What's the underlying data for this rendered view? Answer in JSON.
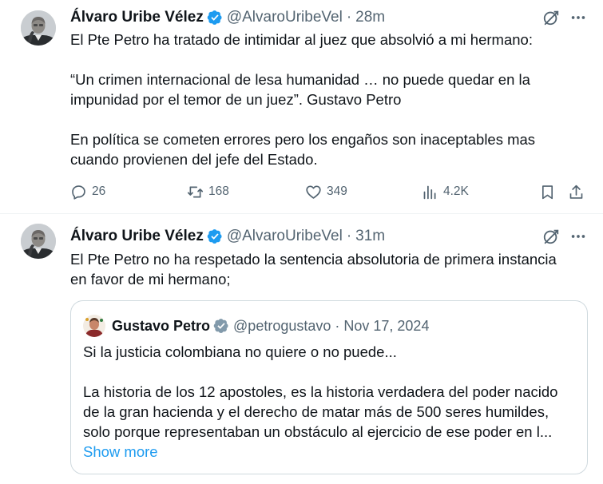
{
  "tweets": [
    {
      "author": {
        "name": "Álvaro Uribe Vélez",
        "handle": "@AlvaroUribeVel",
        "time": "28m",
        "avatar_icon": "person-portrait-icon"
      },
      "text_lines": [
        "El Pte Petro ha tratado de intimidar al juez que absolvió a mi hermano:",
        "",
        "“Un crimen internacional de lesa humanidad … no puede quedar en la",
        "impunidad por el temor de un juez”. Gustavo Petro",
        "",
        "En política se cometen errores pero los engaños son inaceptables mas",
        "cuando provienen del jefe del Estado."
      ],
      "stats": {
        "replies": "26",
        "retweets": "168",
        "likes": "349",
        "views": "4.2K"
      }
    },
    {
      "author": {
        "name": "Álvaro Uribe Vélez",
        "handle": "@AlvaroUribeVel",
        "time": "31m",
        "avatar_icon": "person-portrait-icon"
      },
      "text_lines": [
        "El Pte Petro no ha respetado la sentencia absolutoria de primera instancia",
        "en favor de mi hermano;"
      ],
      "quote": {
        "name": "Gustavo Petro",
        "handle": "@petrogustavo",
        "date": "Nov 17, 2024",
        "text_lines": [
          "Si la justicia colombiana no quiere o no puede...",
          "",
          "La historia de los 12 apostoles, es la historia verdadera del poder nacido",
          "de la gran hacienda y el derecho de matar más de 500 seres humildes,",
          "solo porque representaban un obstáculo al ejercicio de ese poder en l..."
        ],
        "show_more": "Show more"
      }
    }
  ],
  "separator": "·",
  "colors": {
    "text": "#0f1419",
    "muted": "#536471",
    "accent": "#1d9bf0",
    "border": "#cfd9de"
  }
}
